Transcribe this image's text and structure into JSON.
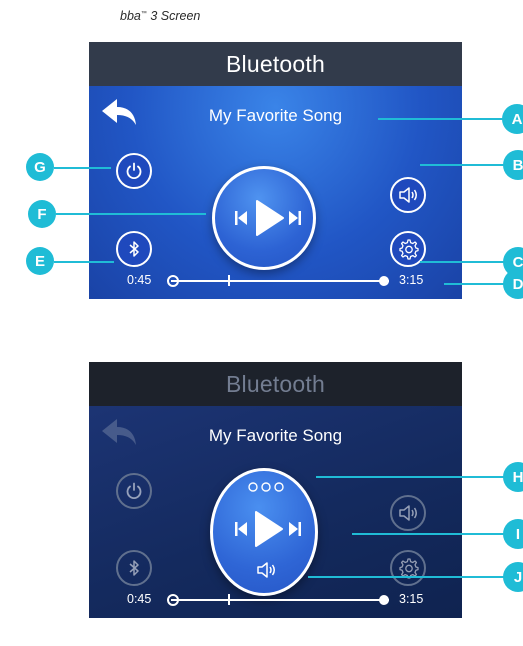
{
  "caption": {
    "text": "bba",
    "tm": "™",
    "rest": " 3 Screen"
  },
  "screen1": {
    "title": "Bluetooth",
    "song": "My Favorite Song",
    "time_elapsed": "0:45",
    "time_total": "3:15",
    "progress_fraction": 0.23
  },
  "screen2": {
    "title": "Bluetooth",
    "song": "My Favorite Song",
    "time_elapsed": "0:45",
    "time_total": "3:15",
    "progress_fraction": 0.23
  },
  "callouts": {
    "A": "A",
    "B": "B",
    "C": "C",
    "D": "D",
    "E": "E",
    "F": "F",
    "G": "G",
    "H": "H",
    "I": "I",
    "J": "J"
  },
  "colors": {
    "accent": "#1fbcd6",
    "screen_blue": "#2156c5",
    "titlebar": "#323b4b"
  },
  "icons": [
    "back-arrow-icon",
    "power-icon",
    "bluetooth-icon",
    "speaker-icon",
    "gear-icon",
    "previous-icon",
    "play-icon",
    "next-icon",
    "more-icon"
  ]
}
